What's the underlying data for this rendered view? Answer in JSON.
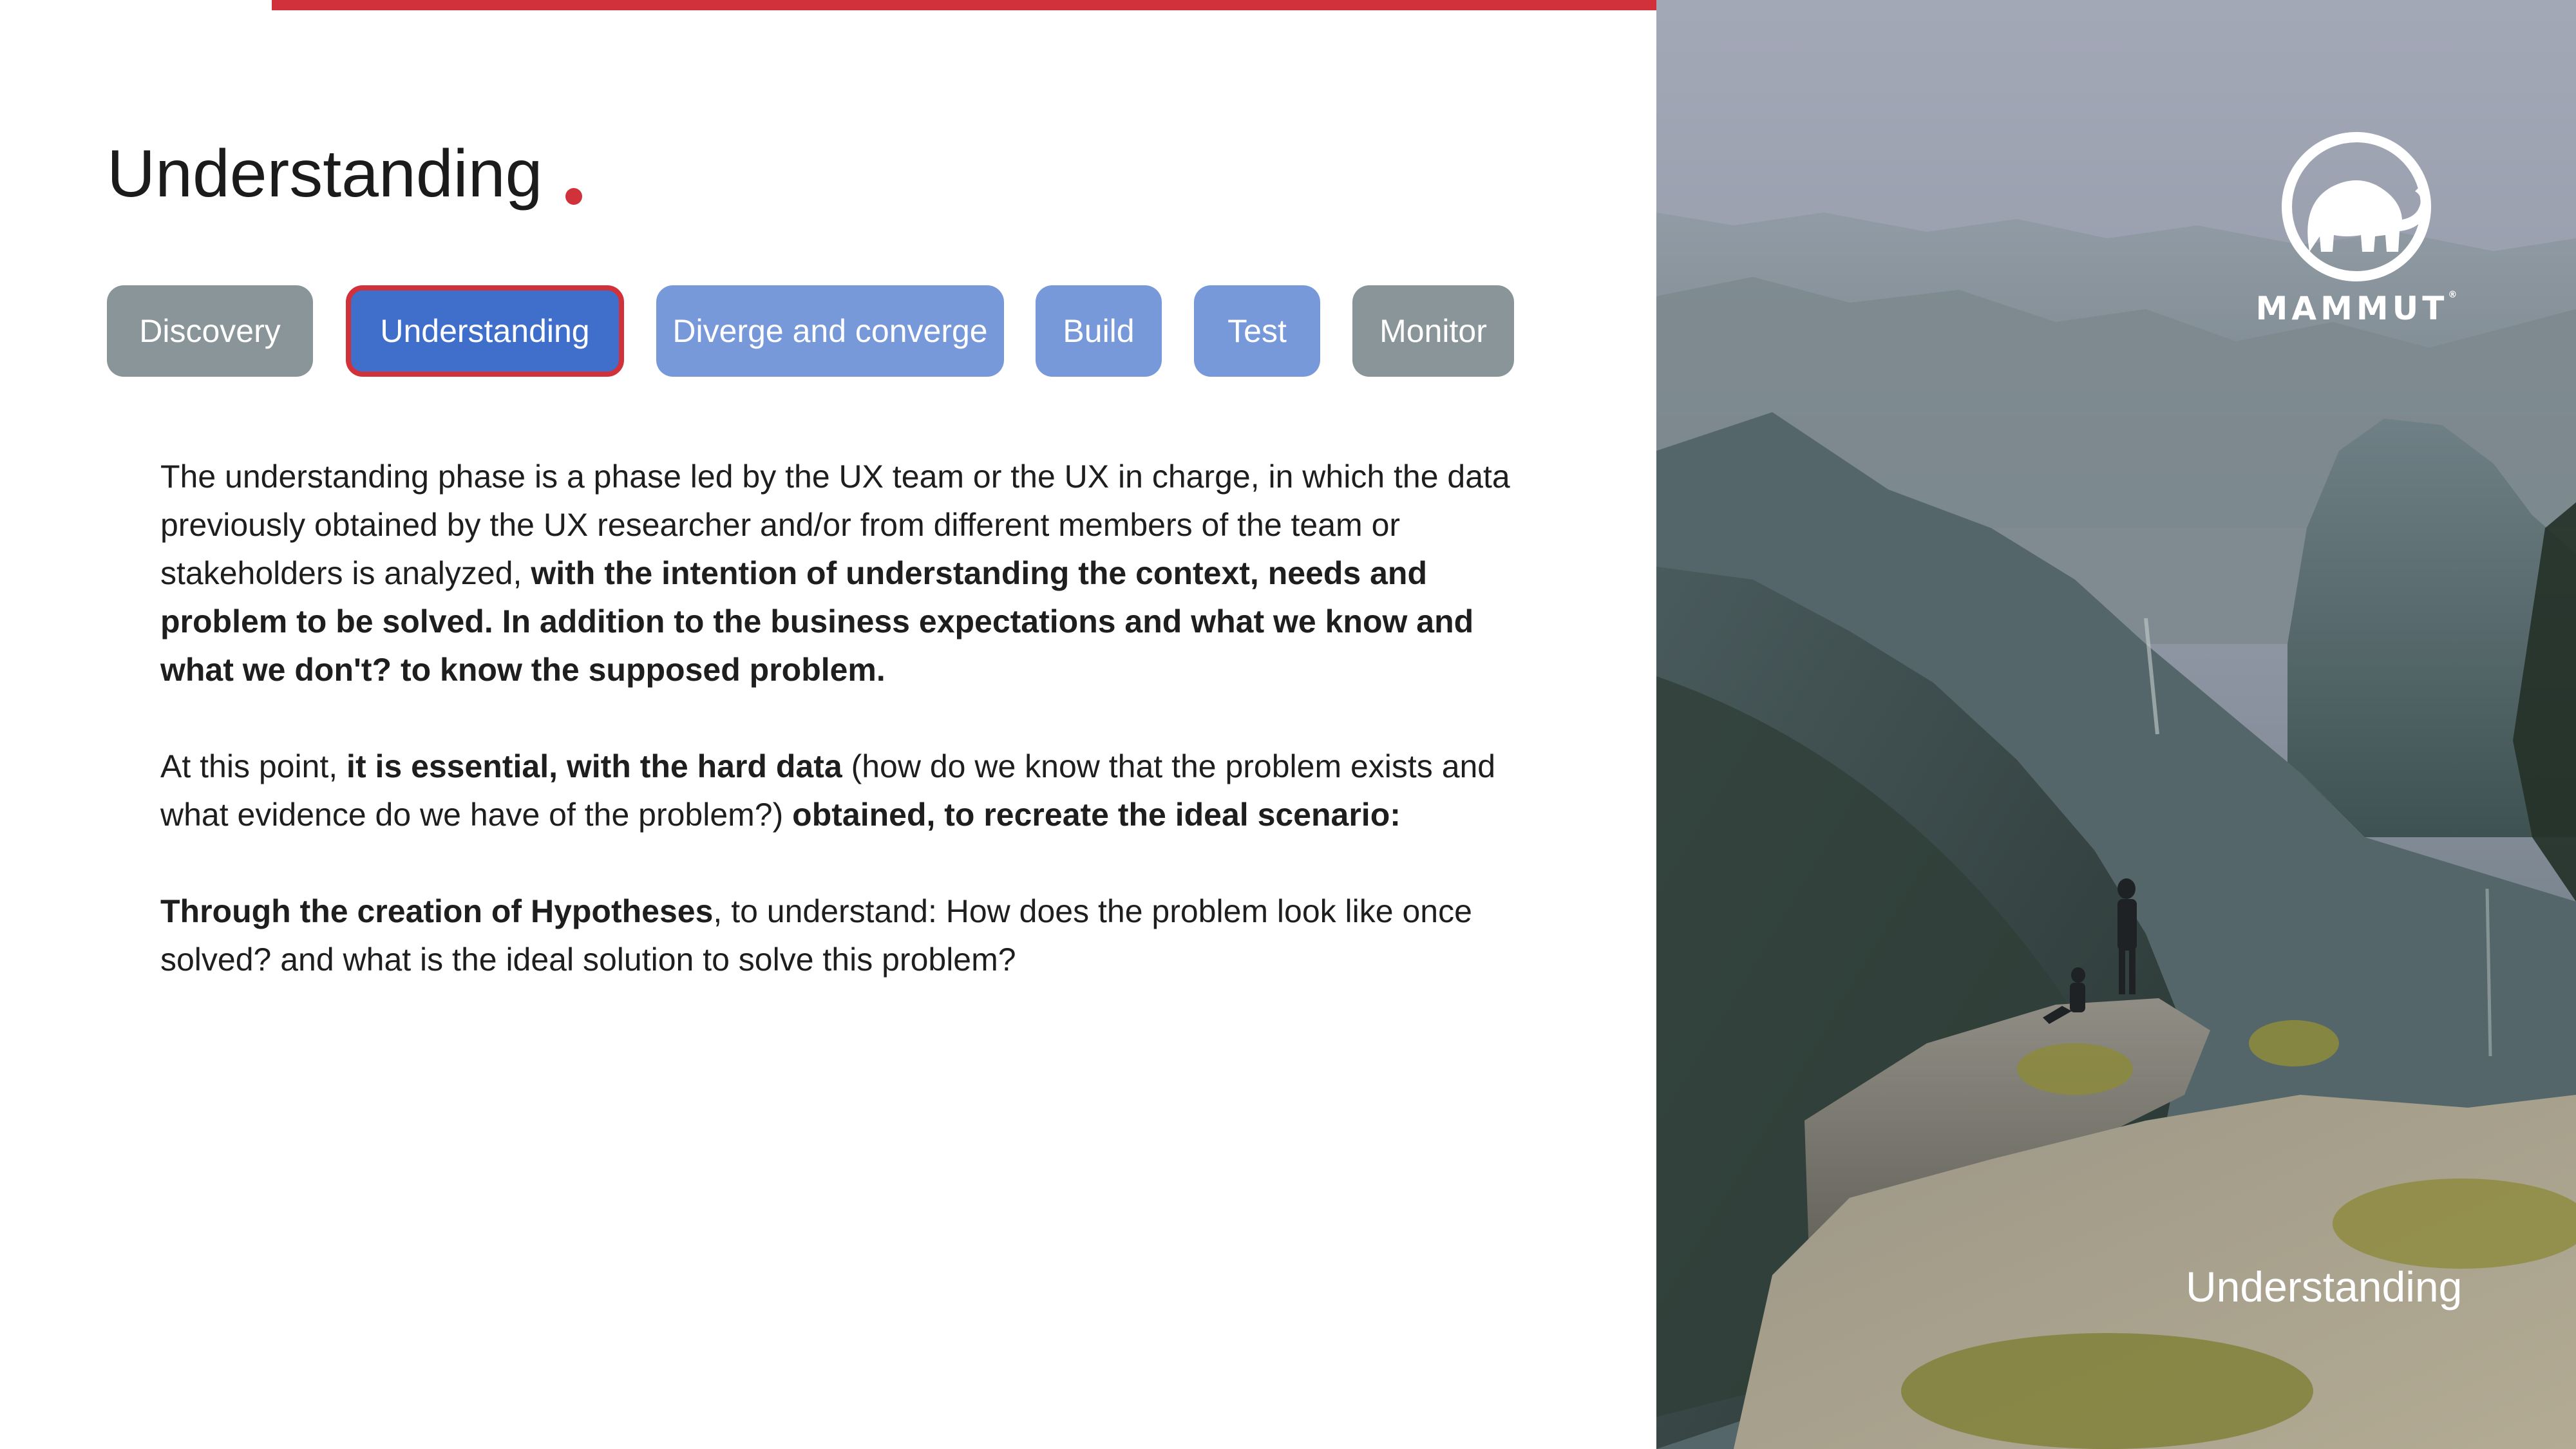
{
  "header": {
    "title": "Understanding",
    "accent_color": "#d0313a"
  },
  "tabs": [
    {
      "label": "Discovery",
      "style": "gray"
    },
    {
      "label": "Understanding",
      "style": "active"
    },
    {
      "label": "Diverge and converge",
      "style": "light"
    },
    {
      "label": "Build",
      "style": "light"
    },
    {
      "label": "Test",
      "style": "light"
    },
    {
      "label": "Monitor",
      "style": "gray"
    }
  ],
  "body": {
    "p1": {
      "normal": "The understanding phase is a phase led by the UX team or the UX in charge, in which the data previously obtained by the UX researcher and/or from different members of the team or stakeholders is analyzed, ",
      "bold": "with the intention of understanding the context, needs and problem to be solved. In addition to the business expectations and what we know and what we don't? to know the supposed problem."
    },
    "p2": {
      "normal1": "At this point, ",
      "bold1": "it is essential, with the hard data",
      "normal2": " (how do we know that the problem exists and what evidence do we have of the problem?) ",
      "bold2": "obtained, to recreate the ideal scenario:"
    },
    "p3": {
      "bold": "Through the creation of Hypotheses",
      "normal": ", to understand: How does the problem look like once solved? and what is the ideal solution to solve this problem?"
    }
  },
  "image_panel": {
    "logo_text": "MAMMUT",
    "logo_mark": "®",
    "caption": "Understanding"
  },
  "colors": {
    "tab_gray": "#8a9599",
    "tab_light": "#7799d9",
    "tab_active": "#3f6fcb"
  }
}
